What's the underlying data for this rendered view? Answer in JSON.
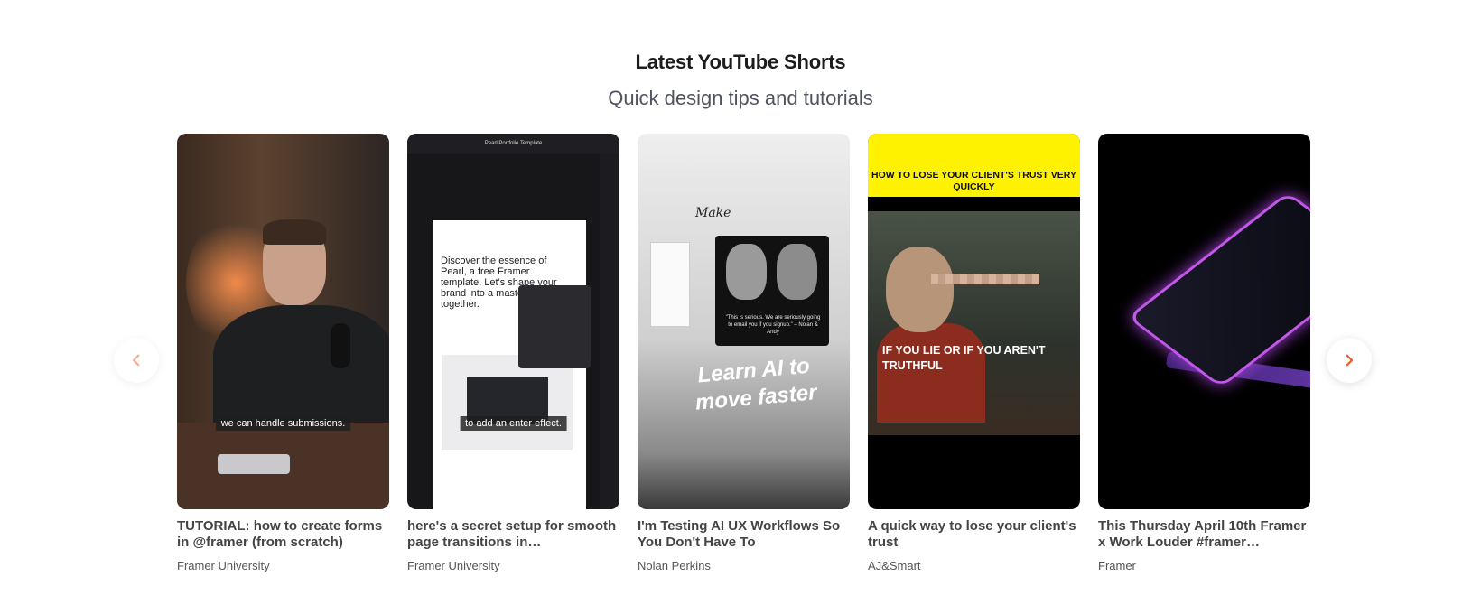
{
  "section": {
    "heading": "Latest YouTube Shorts",
    "subheading": "Quick design tips and tutorials"
  },
  "carousel": {
    "prev_icon": "chevron-left-icon",
    "next_icon": "chevron-right-icon",
    "accent_color": "#f05a22",
    "cards": [
      {
        "title": "TUTORIAL: how to create forms in @framer (from scratch)",
        "channel": "Framer University",
        "caption": "we can handle submissions."
      },
      {
        "title": "here's a secret setup for smooth page transitions in…",
        "channel": "Framer University",
        "caption": "to add an enter effect.",
        "screen_title": "Pearl Portfolio Template",
        "screen_text": "Discover the essence of Pearl, a free Framer template. Let's shape your brand into a masterpiece together."
      },
      {
        "title": "I'm Testing AI UX Workflows So You Don't Have To",
        "channel": "Nolan Perkins",
        "make_text": "Make",
        "quote": "\"This is serious. We are seriously going to email you if you signup.\" – Nolan & Andy",
        "overlay": "Learn AI to move faster"
      },
      {
        "title": "A quick way to lose your client's trust",
        "channel": "AJ&Smart",
        "banner": "HOW TO LOSE YOUR CLIENT'S TRUST VERY QUICKLY",
        "overlay": "IF YOU LIE OR IF YOU AREN'T TRUTHFUL"
      },
      {
        "title": "This Thursday April 10th Framer x Work Louder #framer…",
        "channel": "Framer"
      }
    ]
  }
}
